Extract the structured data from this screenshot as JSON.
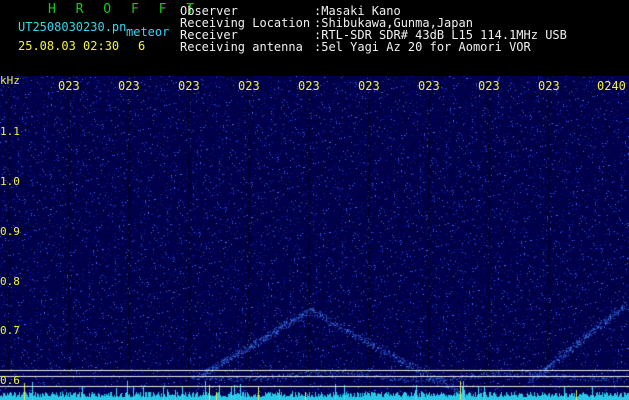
{
  "header": {
    "program_name": "H R O F F T",
    "filename": "UT2508030230.pn",
    "meteor_label": "meteor",
    "datetime": "25.08.03 02:30",
    "meteor_count": "6",
    "observer_label": "Observer",
    "observer_value": ":Masaki Kano",
    "location_label": "Receiving Location",
    "location_value": ":Shibukawa,Gunma,Japan",
    "receiver_label": "Receiver",
    "receiver_value": ":RTL-SDR SDR# 43dB L15 114.1MHz USB",
    "antenna_label": "Receiving antenna",
    "antenna_value": ":5el Yagi Az 20 for Aomori VOR"
  },
  "axes": {
    "y_unit": "kHz",
    "y_ticks": [
      "1.1",
      "1.0",
      "0.9",
      "0.8",
      "0.7",
      "0.6"
    ],
    "x_ticks": [
      "023",
      "023",
      "023",
      "023",
      "023",
      "023",
      "023",
      "023",
      "023",
      "0240"
    ]
  },
  "colors": {
    "background": "#000000",
    "spectrogram_base": "#0a0a5a",
    "signal": "#3c8cff",
    "grid": "#e8e8e8",
    "label_yellow": "#f2f23a",
    "label_cyan": "#37d6ef",
    "title_green": "#17c717"
  }
}
